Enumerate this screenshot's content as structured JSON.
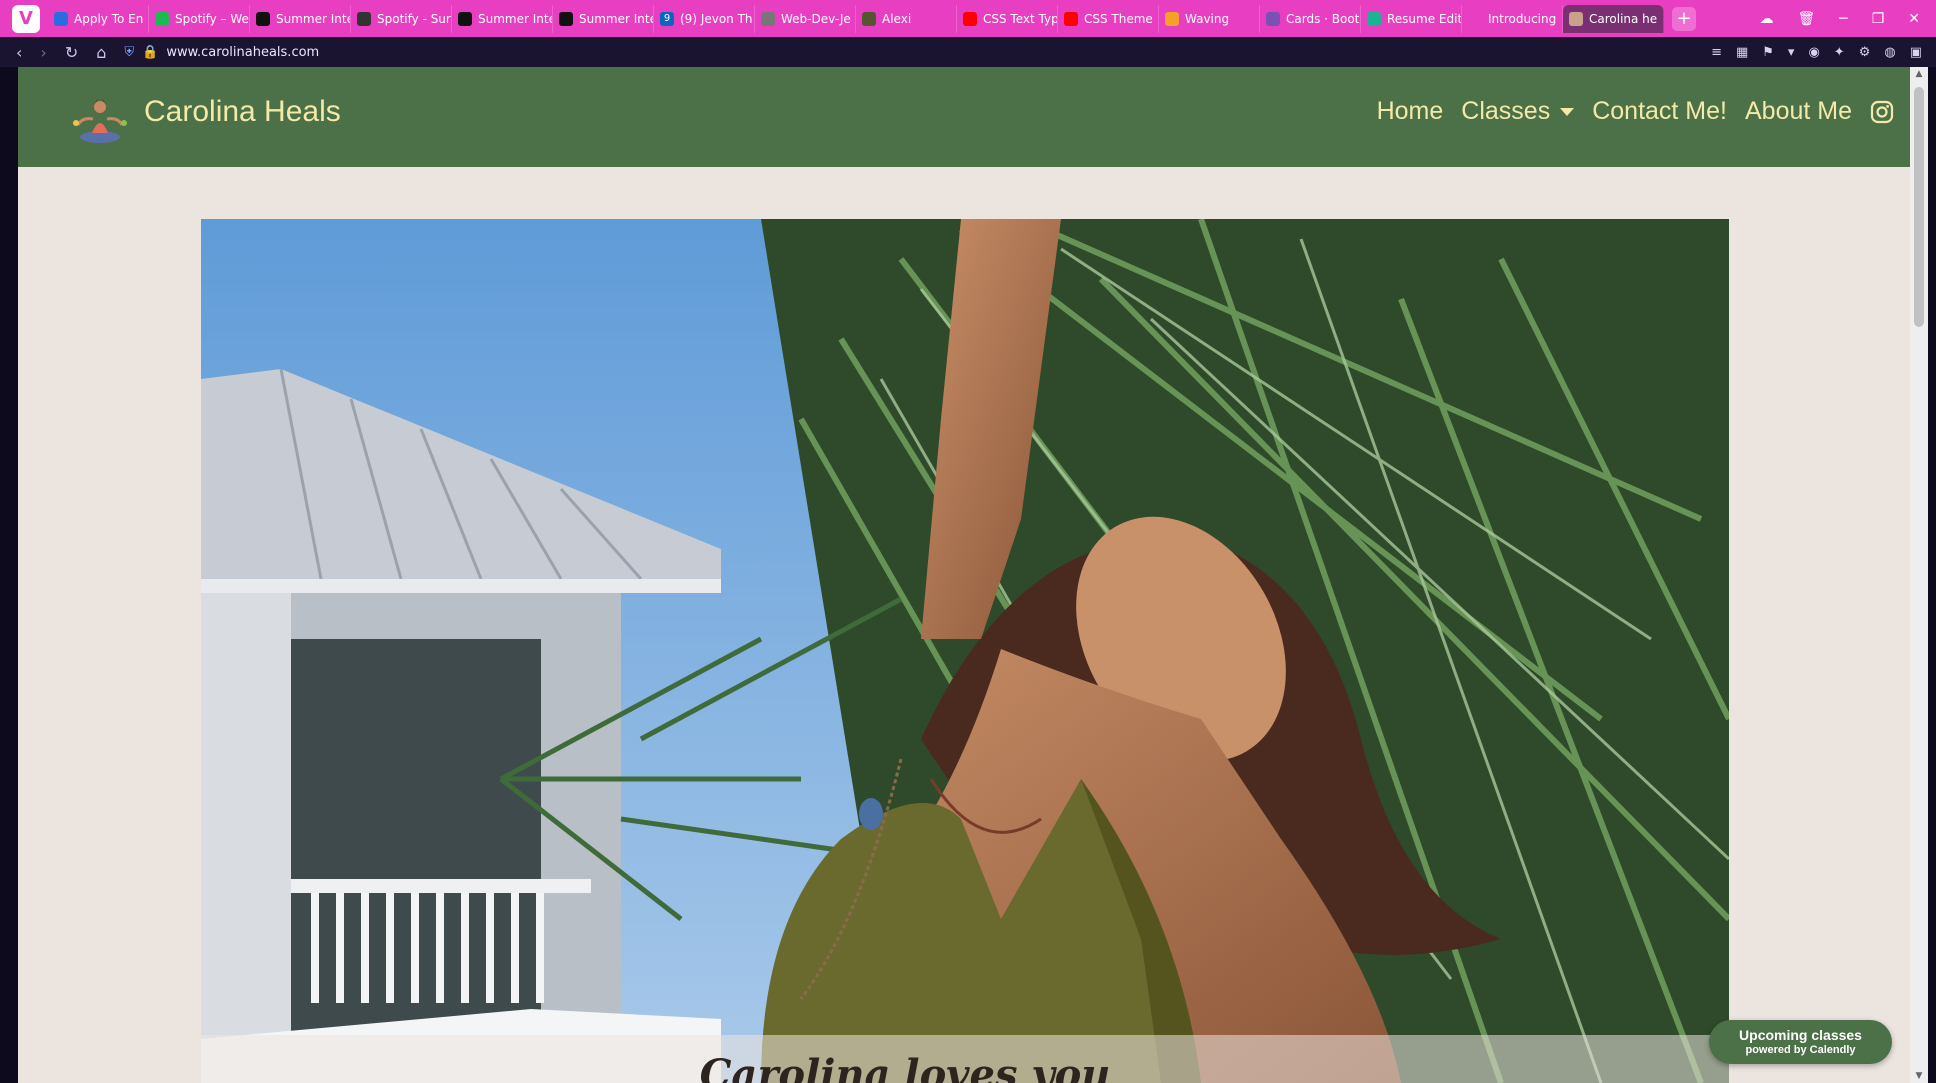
{
  "browser": {
    "tabs": [
      {
        "label": "Apply To En",
        "icon": "apply-favicon",
        "color": "#2b6de0"
      },
      {
        "label": "Spotify – We",
        "icon": "spotify-favicon",
        "color": "#1db954"
      },
      {
        "label": "Summer Inte",
        "icon": "spotify-favicon",
        "color": "#111"
      },
      {
        "label": "Spotify - Sur",
        "icon": "edit-favicon",
        "color": "#333"
      },
      {
        "label": "Summer Inte",
        "icon": "spotify-favicon",
        "color": "#111"
      },
      {
        "label": "Summer Inte",
        "icon": "spotify-favicon",
        "color": "#111"
      },
      {
        "label": "(9) Jevon Th",
        "icon": "linkedin-favicon",
        "color": "#0a66c2"
      },
      {
        "label": "Web-Dev-Je",
        "icon": "doc-favicon",
        "color": "#777"
      },
      {
        "label": "Alexi",
        "icon": "avatar-favicon",
        "color": "#553"
      },
      {
        "label": "CSS Text Typ",
        "icon": "youtube-favicon",
        "color": "#ff0000"
      },
      {
        "label": "CSS Theme",
        "icon": "youtube-favicon",
        "color": "#ff0000"
      },
      {
        "label": "Waving",
        "icon": "waving-favicon",
        "color": "#f6a02c"
      },
      {
        "label": "Cards · Boot",
        "icon": "bootstrap-favicon",
        "color": "#7952b3"
      },
      {
        "label": "Resume Edit",
        "icon": "resume-favicon",
        "color": "#1ab394"
      },
      {
        "label": "Introducing",
        "icon": "blank-favicon",
        "color": "transparent"
      },
      {
        "label": "Carolina he",
        "icon": "site-favicon",
        "color": "#c9a08a",
        "active": true
      }
    ],
    "tab_badge": "9",
    "url": "www.carolinaheals.com"
  },
  "site": {
    "brand": "Carolina Heals",
    "nav": {
      "home": "Home",
      "classes": "Classes",
      "contact": "Contact Me!",
      "about": "About Me"
    },
    "hero_caption": "Carolina loves you",
    "calendly": {
      "line1": "Upcoming classes",
      "line2": "powered by Calendly"
    }
  },
  "colors": {
    "tabbar": "#e83fc2",
    "navbar": "#4c7048",
    "brand_text": "#f3e9a8",
    "page_bg": "#ece4df"
  }
}
